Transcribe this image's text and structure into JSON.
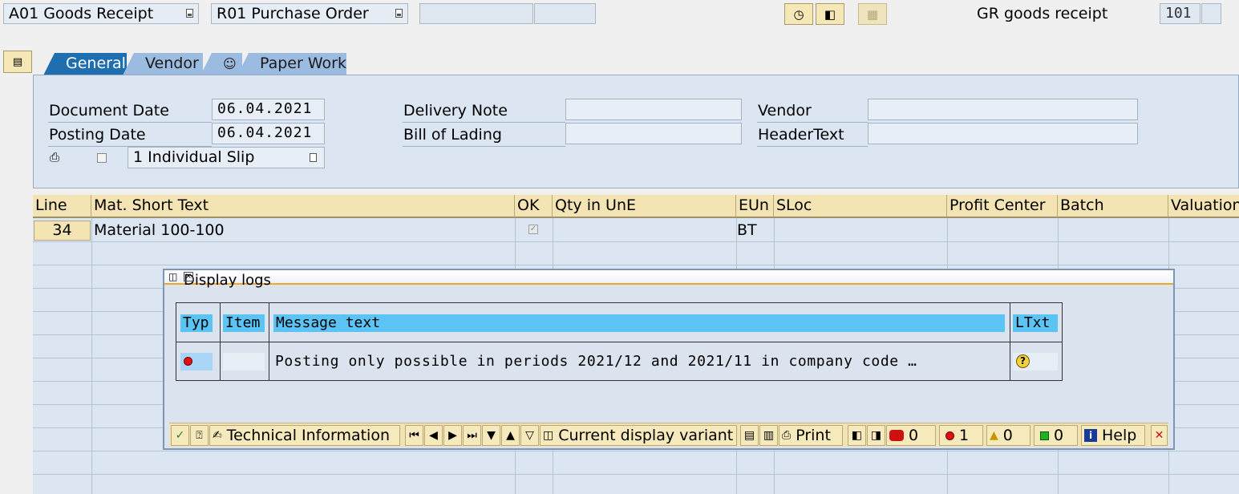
{
  "toolbar": {
    "action_select": "A01 Goods Receipt",
    "reference_select": "R01 Purchase Order",
    "movement_type_label": "GR goods receipt",
    "movement_type_value": "101"
  },
  "tabs": [
    {
      "label": "General",
      "active": true
    },
    {
      "label": "Vendor"
    },
    {
      "label": "Paper Work"
    }
  ],
  "header": {
    "document_date_label": "Document Date",
    "document_date": "06.04.2021",
    "posting_date_label": "Posting Date",
    "posting_date": "06.04.2021",
    "slip_option": "1 Individual Slip",
    "delivery_note_label": "Delivery Note",
    "bill_of_lading_label": "Bill of Lading",
    "vendor_label": "Vendor",
    "header_text_label": "HeaderText"
  },
  "grid": {
    "columns": [
      "Line",
      "Mat. Short Text",
      "OK",
      "Qty in UnE",
      "EUn",
      "SLoc",
      "Profit Center",
      "Batch",
      "Valuation"
    ],
    "rows": [
      {
        "line": "34",
        "text": "Material 100-100",
        "ok": true,
        "qty": "",
        "eun": "BT"
      }
    ]
  },
  "dialog": {
    "title": "Display logs",
    "columns": [
      "Typ",
      "Item",
      "Message text",
      "LTxt"
    ],
    "message": "Posting only possible in periods 2021/12 and 2021/11 in company code …",
    "buttons": {
      "technical_info": "Technical Information",
      "display_variant": "Current display variant",
      "print": "Print",
      "stop_count": "0",
      "error_count": "1",
      "warning_count": "0",
      "success_count": "0",
      "help": "Help"
    }
  },
  "colors": {
    "tab_active": "#1f6fb0",
    "header_bg": "#f4e4b4",
    "log_header": "#5bc4f5",
    "error_red": "#e01010"
  }
}
